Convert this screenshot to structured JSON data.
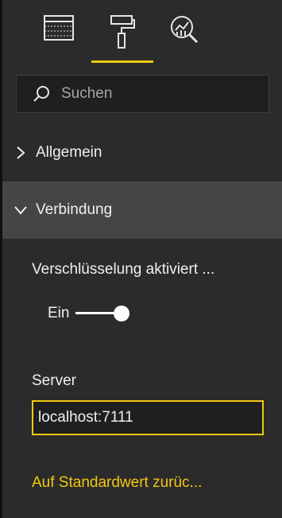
{
  "tabs": [
    {
      "name": "fields",
      "icon": "table-icon"
    },
    {
      "name": "format",
      "icon": "paint-roller-icon",
      "active": true
    },
    {
      "name": "analytics",
      "icon": "analytics-magnifier-icon"
    }
  ],
  "search": {
    "placeholder": "Suchen",
    "icon": "search-icon"
  },
  "sections": {
    "general": {
      "label": "Allgemein",
      "expanded": false
    },
    "connection": {
      "label": "Verbindung",
      "expanded": true
    }
  },
  "connection": {
    "encryption_label": "Verschlüsselung aktiviert ...",
    "encryption_toggle_label": "Ein",
    "encryption_on": true,
    "server_label": "Server",
    "server_value": "localhost:7111",
    "reset_link": "Auf Standardwert zurüc..."
  },
  "colors": {
    "accent": "#f2c811",
    "background": "#2b2b2b",
    "expanded_header": "#454545"
  }
}
